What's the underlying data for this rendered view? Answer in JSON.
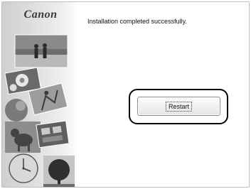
{
  "brand": {
    "logo_text": "Canon"
  },
  "main": {
    "message": "Installation completed successfully.",
    "restart_label": "Restart"
  },
  "collage": {
    "items": [
      "beach-photo",
      "flower-photo",
      "sports-photo",
      "dog-photo",
      "clock-photo",
      "tree-photo"
    ]
  },
  "colors": {
    "highlight_ring": "#000000",
    "button_border": "#8f8f8f"
  }
}
